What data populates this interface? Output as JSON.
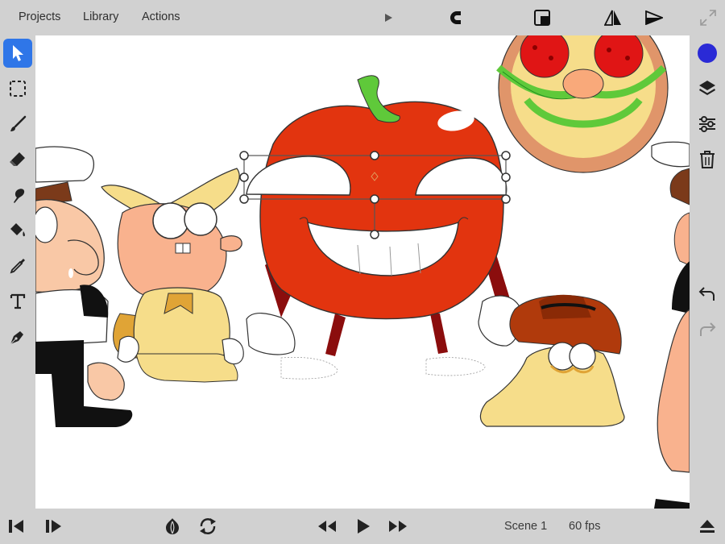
{
  "menu": {
    "projects": "Projects",
    "library": "Library",
    "actions": "Actions"
  },
  "toolbar_icons": [
    "play-icon",
    "magnet-icon",
    "layer-order-icon",
    "flip-icon",
    "send-icon",
    "expand-icon"
  ],
  "left_tools": [
    "select-arrow",
    "marquee-select",
    "brush",
    "eraser",
    "smudge",
    "paint-bucket",
    "eyedropper",
    "text",
    "pen"
  ],
  "active_tool": "select-arrow",
  "right_tools": [
    "color-swatch",
    "layers",
    "adjustments",
    "trash",
    "undo",
    "redo"
  ],
  "current_color": "#2a2ad6",
  "status": {
    "scene": "Scene 1",
    "fps": "60 fps"
  },
  "bottom_icons": [
    "step-back-icon",
    "step-forward-icon",
    "onion-skin-icon",
    "loop-icon",
    "rewind-icon",
    "play-icon",
    "fast-forward-icon",
    "eject-icon"
  ]
}
